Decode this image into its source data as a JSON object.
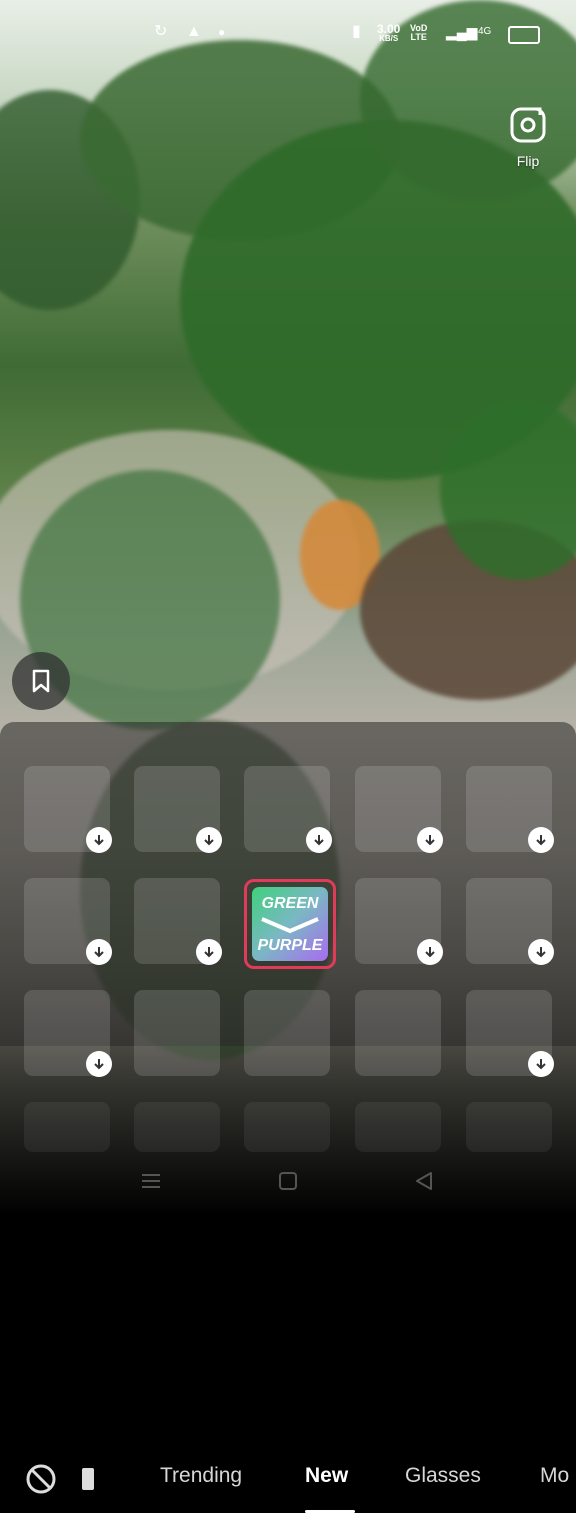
{
  "status_bar": {
    "speed_value": "3.00",
    "speed_unit": "KB/S",
    "network_labels": [
      "VoD",
      "LTE"
    ],
    "signal_label": "4G"
  },
  "camera": {
    "flip_label": "Flip"
  },
  "effects_panel": {
    "tabs": [
      {
        "label": "Trending",
        "active": false
      },
      {
        "label": "New",
        "active": true
      },
      {
        "label": "Glasses",
        "active": false
      },
      {
        "label": "Mo",
        "active": false
      }
    ],
    "selected_effect": {
      "line1": "GREEN",
      "line2": "PURPLE"
    }
  },
  "colors": {
    "selection_border": "#e03b58",
    "active_tab": "#ffffff",
    "inactive_tab": "#d7d7d7"
  }
}
